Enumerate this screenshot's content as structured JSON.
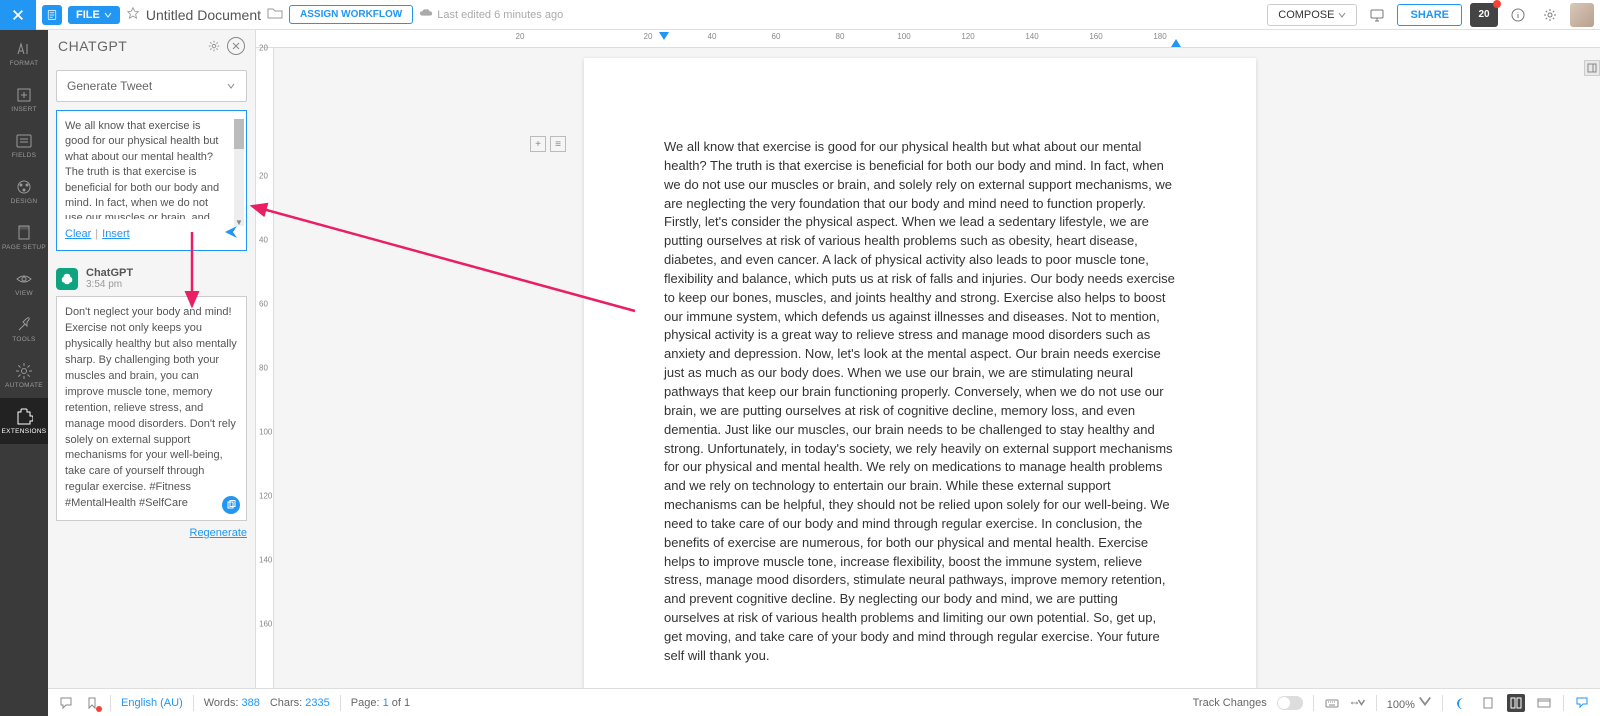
{
  "topbar": {
    "file_label": "FILE",
    "doc_title": "Untitled Document",
    "assign_label": "ASSIGN WORKFLOW",
    "last_edited": "Last edited 6 minutes ago",
    "compose_label": "COMPOSE",
    "share_label": "SHARE",
    "notif_text": "20"
  },
  "sidebar": {
    "items": [
      {
        "label": "FORMAT"
      },
      {
        "label": "INSERT"
      },
      {
        "label": "FIELDS"
      },
      {
        "label": "DESIGN"
      },
      {
        "label": "PAGE SETUP"
      },
      {
        "label": "VIEW"
      },
      {
        "label": "TOOLS"
      },
      {
        "label": "AUTOMATE"
      },
      {
        "label": "EXTENSIONS"
      }
    ]
  },
  "panel": {
    "title": "CHATGPT",
    "dropdown_label": "Generate Tweet",
    "input_text": "We all know that exercise is good for our physical health but what about our mental health? The truth is that exercise is beneficial for both our body and mind. In fact, when we do not use our muscles or brain, and solely",
    "clear_label": "Clear",
    "insert_label": "Insert",
    "chat_name": "ChatGPT",
    "chat_time": "3:54 pm",
    "chat_body": "Don't neglect your body and mind! Exercise not only keeps you physically healthy but also mentally sharp. By challenging both your muscles and brain, you can improve muscle tone, memory retention, relieve stress, and manage mood disorders. Don't rely solely on external support mechanisms for your well-being, take care of yourself through regular exercise. #Fitness #MentalHealth #SelfCare",
    "regenerate_label": "Regenerate"
  },
  "ruler": {
    "h_marks": [
      20,
      20,
      40,
      60,
      80,
      100,
      120,
      140,
      160,
      180
    ],
    "v_marks": [
      20,
      20,
      40,
      60,
      80,
      100,
      120,
      140,
      160
    ]
  },
  "document": {
    "body": "We all know that exercise is good for our physical health but what about our mental health? The truth is that exercise is beneficial for both our body and mind. In fact, when we do not use our muscles or brain, and solely rely on external support mechanisms, we are neglecting the very foundation that our body and mind need to function properly. Firstly, let's consider the physical aspect. When we lead a sedentary lifestyle, we are putting ourselves at risk of various health problems such as obesity, heart disease, diabetes, and even cancer. A lack of physical activity also leads to poor muscle tone, flexibility and balance, which puts us at risk of falls and injuries. Our body needs exercise to keep our bones, muscles, and joints healthy and strong. Exercise also helps to boost our immune system, which defends us against illnesses and diseases. Not to mention, physical activity is a great way to relieve stress and manage mood disorders such as anxiety and depression. Now, let's look at the mental aspect. Our brain needs exercise just as much as our body does. When we use our brain, we are stimulating neural pathways that keep our brain functioning properly. Conversely, when we do not use our brain, we are putting ourselves at risk of cognitive decline, memory loss, and even dementia. Just like our muscles, our brain needs to be challenged to stay healthy and strong. Unfortunately, in today's society, we rely heavily on external support mechanisms for our physical and mental health. We rely on medications to manage health problems and we rely on technology to entertain our brain. While these external support mechanisms can be helpful, they should not be relied upon solely for our well-being. We need to take care of our body and mind through regular exercise. In conclusion, the benefits of exercise are numerous, for both our physical and mental health. Exercise helps to improve muscle tone, increase flexibility, boost the immune system, relieve stress, manage mood disorders, stimulate neural pathways, improve memory retention, and prevent cognitive decline. By neglecting our body and mind, we are putting ourselves at risk of various health problems and limiting our own potential. So, get up, get moving, and take care of your body and mind through regular exercise. Your future self will thank you."
  },
  "statusbar": {
    "language": "English (AU)",
    "words_label": "Words:",
    "words_value": "388",
    "chars_label": "Chars:",
    "chars_value": "2335",
    "page_label": "Page:",
    "page_current": "1",
    "page_of": "of",
    "page_total": "1",
    "track_label": "Track Changes",
    "zoom_value": "100%"
  }
}
